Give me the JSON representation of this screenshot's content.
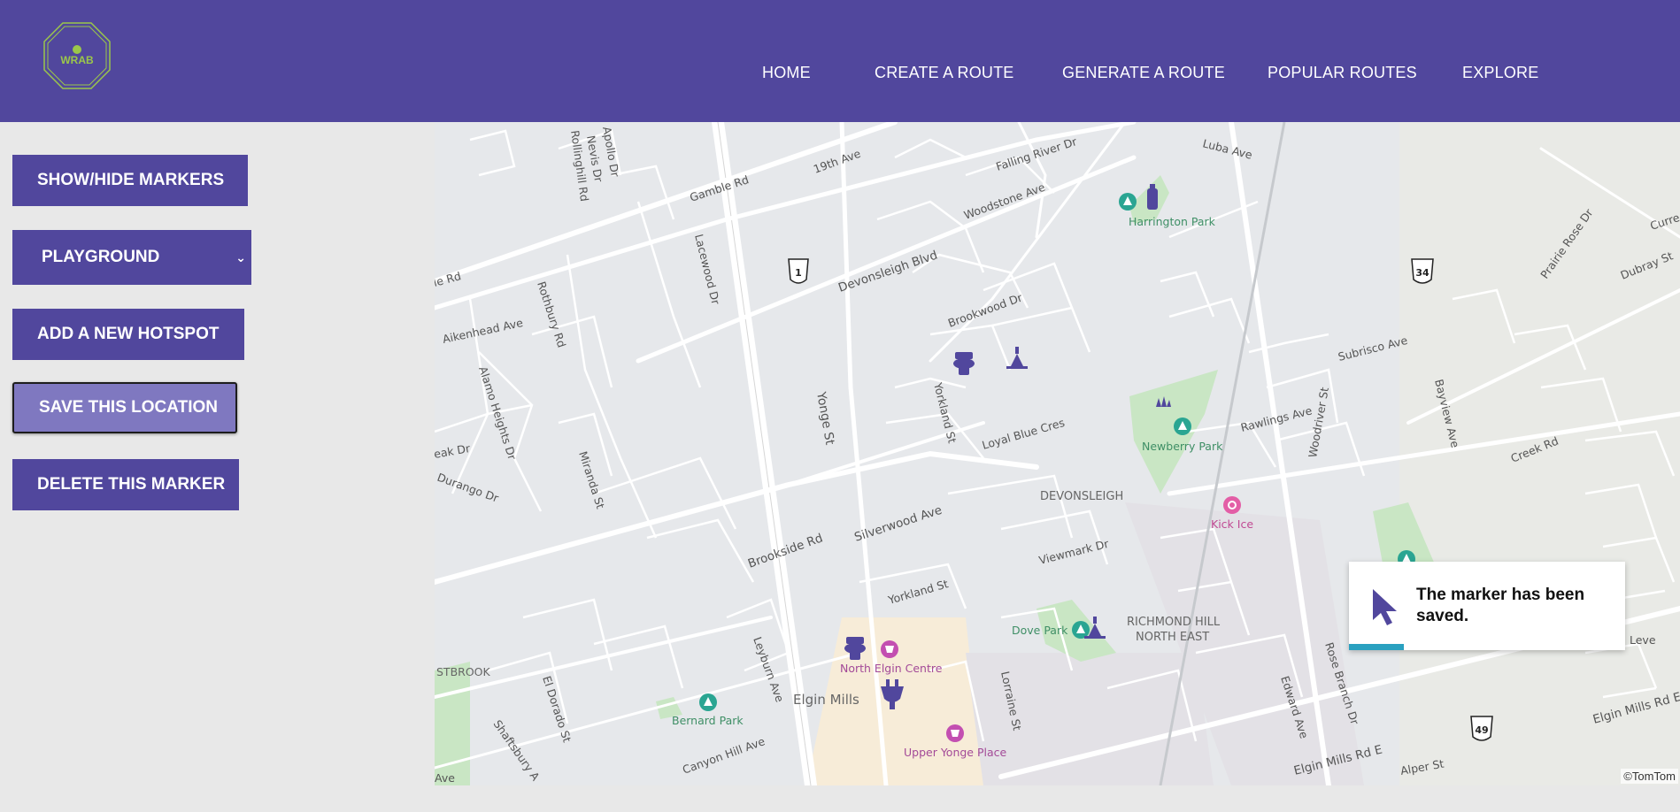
{
  "header": {
    "logo_text": "WRAB",
    "nav": [
      {
        "label": "HOME"
      },
      {
        "label": "CREATE A ROUTE"
      },
      {
        "label": "GENERATE A ROUTE"
      },
      {
        "label": "POPULAR ROUTES"
      },
      {
        "label": "EXPLORE"
      }
    ]
  },
  "sidebar": {
    "show_hide_markers": "SHOW/HIDE MARKERS",
    "category_select": {
      "selected": "PLAYGROUND"
    },
    "add_hotspot": "ADD A NEW HOTSPOT",
    "save_location": "SAVE THIS LOCATION",
    "delete_marker": "DELETE THIS MARKER"
  },
  "map": {
    "copyright": "©TomTom",
    "shields": [
      "1",
      "34",
      "49"
    ],
    "street_labels": [
      "Gamble Rd",
      "19th Ave",
      "Falling River Dr",
      "Luba Ave",
      "Woodstone Ave",
      "Devonsleigh Blvd",
      "Brookwood Dr",
      "Yonge St",
      "Yorkland St",
      "Loyal Blue Cres",
      "Rothbury Rd",
      "Aikenhead Ave",
      "Alamo Heights Dr",
      "Miranda St",
      "Durango Dr",
      "Brookside Rd",
      "Silverwood Ave",
      "Viewmark Dr",
      "Yorkland St",
      "Leyburn Ave",
      "El Dorado St",
      "Shaftsbury A",
      "Canyon Hill Ave",
      "Lorraine St",
      "Edward Ave",
      "Rose Branch Dr",
      "Elgin Mills Rd E",
      "Alper St",
      "Bayview Ave",
      "Subrisco Ave",
      "Rawlings Ave",
      "Woodriver St",
      "Creek Rd",
      "Prairie Rose Dr",
      "Dubray St",
      "Lacewood Dr",
      "Rollinghill Rd",
      "Rothbury Rd",
      "Elgin Mills Rd E",
      "le Rd",
      "eak Dr",
      "Ave",
      "Curre",
      "Leve",
      "Apollo Dr",
      "Nevis Dr"
    ],
    "place_labels": [
      "Harrington Park",
      "Newberry Park",
      "DEVONSLEIGH",
      "Kick Ice",
      "Dove Park",
      "RICHMOND HILL",
      "NORTH EAST",
      "North Elgin Centre",
      "Elgin Mills",
      "Upper Yonge Place",
      "Bernard Park",
      "STBROOK"
    ]
  },
  "toast": {
    "message": "The marker has been saved.",
    "progress": 0.2
  },
  "colors": {
    "header_bg": "#51479d",
    "button_bg": "#51479d",
    "button_active_bg": "#7f78c0",
    "toast_progress": "#2aa1c0",
    "park_green": "#c9e6c4",
    "marker_purple": "#51479d",
    "poi_teal": "#2aa592",
    "poi_pink": "#d14fae"
  }
}
